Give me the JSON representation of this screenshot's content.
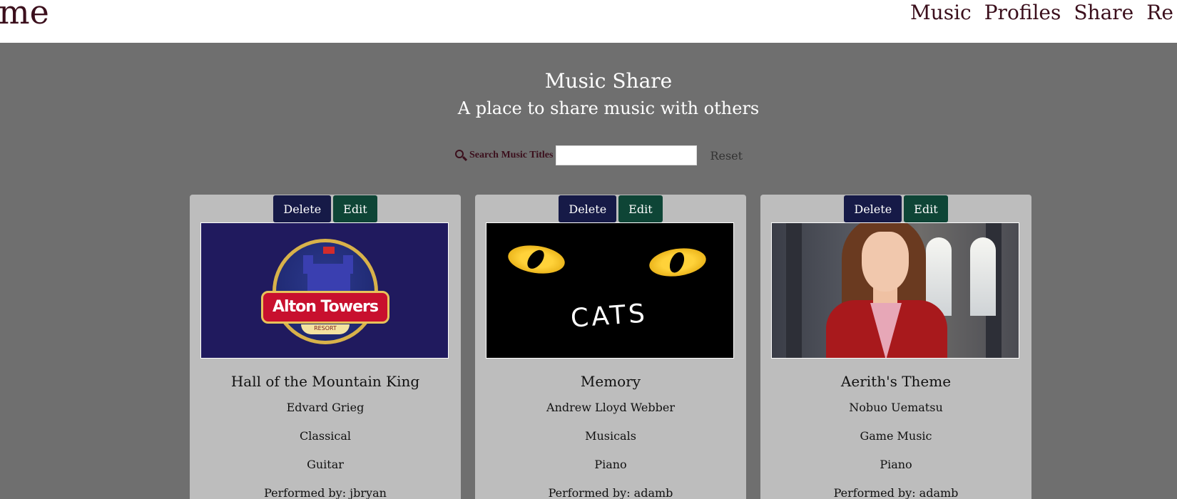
{
  "header": {
    "brand": "me",
    "nav": [
      "Music",
      "Profiles",
      "Share",
      "Re"
    ]
  },
  "hero": {
    "title": "Music Share",
    "subtitle": "A place to share music with others"
  },
  "search": {
    "label": "Search Music Titles",
    "value": "",
    "reset_label": "Reset"
  },
  "cards": [
    {
      "delete_label": "Delete",
      "edit_label": "Edit",
      "image_label": "Alton Towers",
      "image_sublabel": "RESORT",
      "title": "Hall of the Mountain King",
      "composer": "Edvard Grieg",
      "genre": "Classical",
      "instrument": "Guitar",
      "performer": "Performed by: jbryan"
    },
    {
      "delete_label": "Delete",
      "edit_label": "Edit",
      "image_label": "CATS",
      "title": "Memory",
      "composer": "Andrew Lloyd Webber",
      "genre": "Musicals",
      "instrument": "Piano",
      "performer": "Performed by: adamb"
    },
    {
      "delete_label": "Delete",
      "edit_label": "Edit",
      "title": "Aerith's Theme",
      "composer": "Nobuo Uematsu",
      "genre": "Game Music",
      "instrument": "Piano",
      "performer": "Performed by: adamb"
    }
  ],
  "colors": {
    "background": "#6f6f6f",
    "card": "#bdbdbd",
    "brand": "#3b0f1c",
    "delete_button": "#161a47",
    "edit_button": "#0e4536"
  }
}
